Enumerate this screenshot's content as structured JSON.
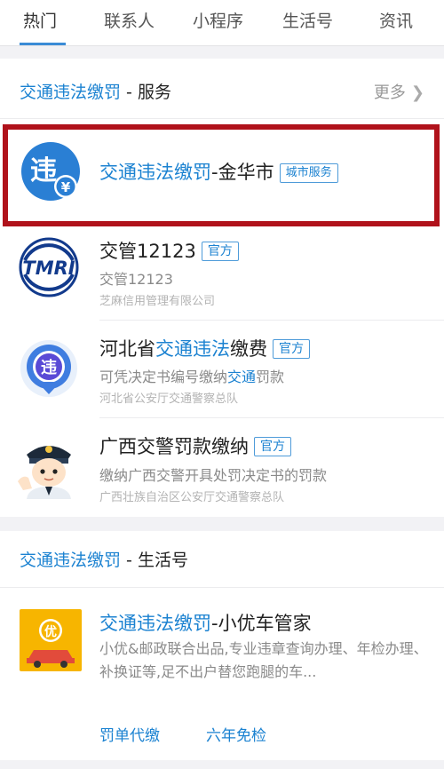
{
  "tabs": [
    {
      "label": "热门"
    },
    {
      "label": "联系人"
    },
    {
      "label": "小程序"
    },
    {
      "label": "生活号"
    },
    {
      "label": "资讯"
    }
  ],
  "service_section": {
    "title_keyword": "交通违法缴罚",
    "title_suffix": " - 服务",
    "more_label": "更多"
  },
  "services": [
    {
      "title_keyword": "交通违法缴罚",
      "title_suffix": "-金华市",
      "badge": "城市服务",
      "icon_char": "违",
      "icon_sub": "¥"
    },
    {
      "title": "交管12123",
      "badge": "官方",
      "subtitle": "交管12123",
      "org": "芝麻信用管理有限公司",
      "icon_text": "TMRI"
    },
    {
      "title_prefix": "河北省",
      "title_keyword": "交通违法",
      "title_suffix": "缴费",
      "badge": "官方",
      "subtitle_prefix": "可凭决定书编号缴纳",
      "subtitle_keyword": "交通",
      "subtitle_suffix": "罚款",
      "org": "河北省公安厅交通警察总队",
      "icon_char": "违"
    },
    {
      "title": "广西交警罚款缴纳",
      "badge": "官方",
      "subtitle": "缴纳广西交警开具处罚决定书的罚款",
      "org": "广西壮族自治区公安厅交通警察总队"
    }
  ],
  "life_section": {
    "title_keyword": "交通违法缴罚",
    "title_suffix": " - 生活号"
  },
  "life_account": {
    "title_keyword": "交通违法缴罚",
    "title_suffix": "-小优车管家",
    "description": "小优&邮政联合出品,专业违章查询办理、年检办理、补换证等,足不出户替您跑腿的车...",
    "icon_char": "优",
    "links": [
      "罚单代缴",
      "六年免检"
    ]
  },
  "colors": {
    "accent": "#1b82d1",
    "highlight_border": "#b0121b",
    "icon_blue": "#2a7fd4",
    "icon_yellow": "#f7b500"
  }
}
